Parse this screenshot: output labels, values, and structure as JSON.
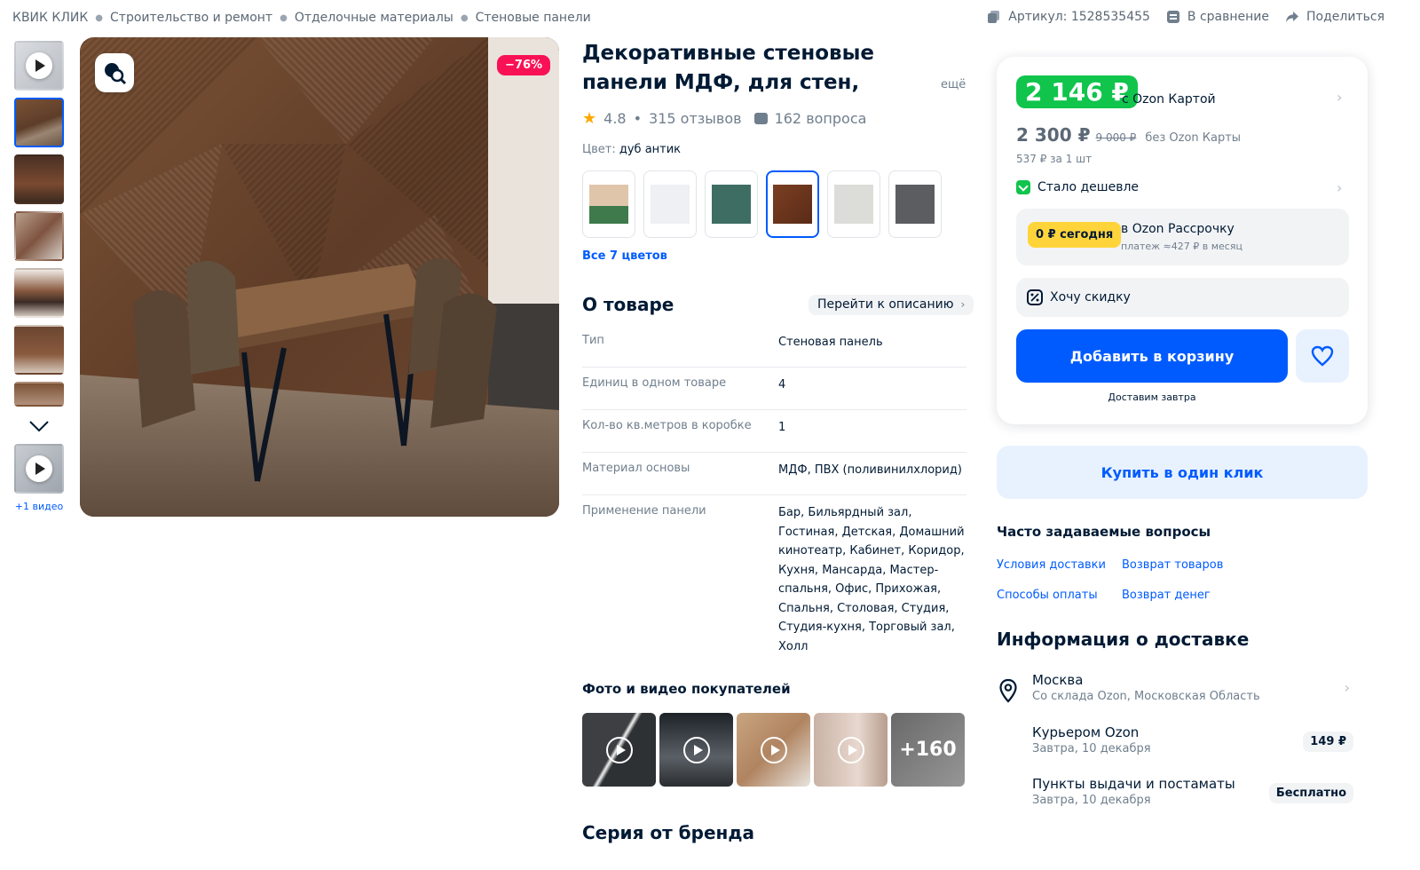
{
  "breadcrumb": [
    "КВИК КЛИК",
    "Строительство и ремонт",
    "Отделочные материалы",
    "Стеновые панели"
  ],
  "top_actions": {
    "sku": "Артикул: 1528535455",
    "compare": "В сравнение",
    "share": "Поделиться"
  },
  "gallery": {
    "video_label": "+1 видео",
    "discount_badge": "−76%"
  },
  "product": {
    "title": "Декоративные стеновые панели МДФ, для стен, интерьерные, д",
    "title_more": "ещё",
    "rating": "4.8",
    "reviews": "315 отзывов",
    "questions": "162 вопроса",
    "color_label": "Цвет:",
    "color_value": "дуб антик",
    "all_colors": "Все 7 цветов",
    "swatches": [
      {
        "color": "#d9c0a5",
        "accent": "#3f7a4c"
      },
      {
        "color": "#eef0f3",
        "accent": "#eef0f3"
      },
      {
        "color": "#3e6e63",
        "accent": "#3e6e63"
      },
      {
        "color": "#6b3a22",
        "accent": "#6b3a22"
      },
      {
        "color": "#dadad6",
        "accent": "#dadad6"
      },
      {
        "color": "#5b5d61",
        "accent": "#5b5d61"
      }
    ]
  },
  "about": {
    "heading": "О товаре",
    "to_description": "Перейти к описанию",
    "specs": [
      {
        "key": "Тип",
        "value": "Стеновая панель"
      },
      {
        "key": "Единиц в одном товаре",
        "value": "4"
      },
      {
        "key": "Кол-во кв.метров в коробке",
        "value": "1"
      },
      {
        "key": "Материал основы",
        "value": "МДФ, ПВХ (поливинилхлорид)"
      },
      {
        "key": "Применение панели",
        "value": "Бар, Бильярдный зал, Гостиная, Детская, Домашний кинотеатр, Кабинет, Коридор, Кухня, Мансарда, Мастер-спальня, Офис, Прихожая, Спальня, Столовая, Студия, Студия-кухня, Торговый зал, Холл"
      }
    ]
  },
  "customer_media": {
    "heading": "Фото и видео покупателей",
    "more_count": "+160"
  },
  "series": {
    "heading": "Серия от бренда"
  },
  "buy": {
    "card_price": "2 146 ₽",
    "card_price_label": "с Ozon Картой",
    "price": "2 300 ₽",
    "old_price": "9 000 ₽",
    "price_label": "без Ozon Карты",
    "per_unit": "537 ₽ за 1 шт",
    "cheaper": "Стало дешевле",
    "installment_badge": "0 ₽ сегодня",
    "installment_title": "в Ozon Рассрочку",
    "installment_sub": "платеж ≈427 ₽ в месяц",
    "want_discount": "Хочу скидку",
    "add_to_cart": "Добавить в корзину",
    "deliver_tomorrow": "Доставим завтра",
    "one_click": "Купить в один клик"
  },
  "faq": {
    "heading": "Часто задаваемые вопросы",
    "links": [
      "Условия доставки",
      "Возврат товаров",
      "Способы оплаты",
      "Возврат денег"
    ]
  },
  "delivery": {
    "heading": "Информация о доставке",
    "city": "Москва",
    "warehouse": "Со склада Ozon, Московская Область",
    "options": [
      {
        "title": "Курьером Ozon",
        "date": "Завтра, 10 декабря",
        "price": "149 ₽"
      },
      {
        "title": "Пункты выдачи и постаматы",
        "date": "Завтра, 10 декабря",
        "price": "Бесплатно"
      }
    ]
  }
}
